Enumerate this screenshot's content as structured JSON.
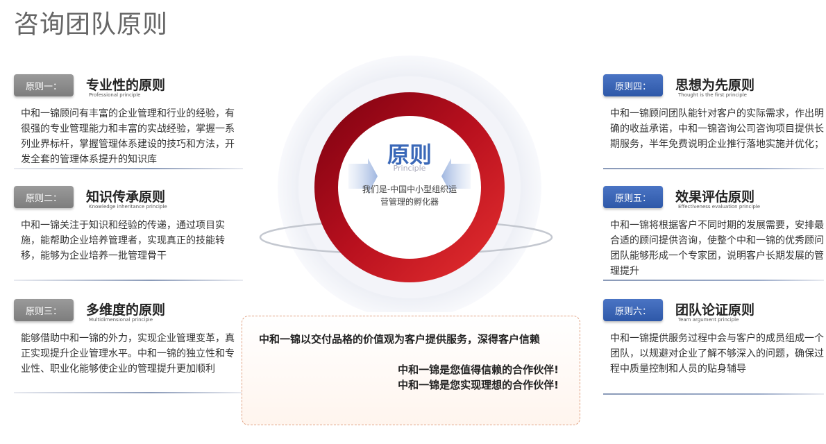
{
  "page_title": "咨询团队原则",
  "center": {
    "title": "原则",
    "subtitle": "Principle",
    "description": "我们是-中国中小型组织运营管理的孵化器"
  },
  "principles": [
    {
      "badge": "原则一：",
      "title": "专业性的原则",
      "subtitle": "Professional principle",
      "body": "中和一锦顾问有丰富的企业管理和行业的经验，有很强的专业管理能力和丰富的实战经验，掌握一系列业界标杆，掌握管理体系建设的技巧和方法，开发全套的管理体系提升的知识库"
    },
    {
      "badge": "原则二：",
      "title": "知识传承原则",
      "subtitle": "Knowledge inheritance principle",
      "body": "中和一锦关注于知识和经验的传递，通过项目实施，能帮助企业培养管理者，实现真正的技能转移，能够为企业培养一批管理骨干"
    },
    {
      "badge": "原则三：",
      "title": "多维度的原则",
      "subtitle": "Multidimensional principle",
      "body": "能够借助中和一锦的外力，实现企业管理变革，真正实现提升企业管理水平。中和一锦的独立性和专业性、职业化能够使企业的管理提升更加顺利"
    },
    {
      "badge": "原则四：",
      "title": "思想为先原则",
      "subtitle": "Thought is the first principle",
      "body": "中和一锦顾问团队能针对客户的实际需求，作出明确的收益承诺，中和一锦咨询公司咨询项目提供长期服务，半年免费说明企业推行落地实施并优化；"
    },
    {
      "badge": "原则五：",
      "title": "效果评估原则",
      "subtitle": "Effectiveness evaluation principle",
      "body": "中和一锦将根据客户不同时期的发展需要，安排最合适的顾问提供咨询，使整个中和一锦的优秀顾问团队能够形成一个专家团，说明客户长期发展的管理提升"
    },
    {
      "badge": "原则六：",
      "title": "团队论证原则",
      "subtitle": "Team argument principle",
      "body": "中和一锦提供服务过程中会与客户的成员组成一个团队，以规避对企业了解不够深入的问题，确保过程中质量控制和人员的贴身辅导"
    }
  ],
  "callout": {
    "line1": "中和一锦以交付品格的价值观为客户提供服务，深得客户信赖",
    "line2": "中和一锦是您值得信赖的合作伙伴!",
    "line3": "中和一锦是您实现理想的合作伙伴!"
  },
  "colors": {
    "ring_dark": "#8b0010",
    "ring_light": "#e0202a",
    "badge_gray": "#8a8a8a",
    "badge_blue": "#3a64b4",
    "center_title": "#3a68b8"
  }
}
